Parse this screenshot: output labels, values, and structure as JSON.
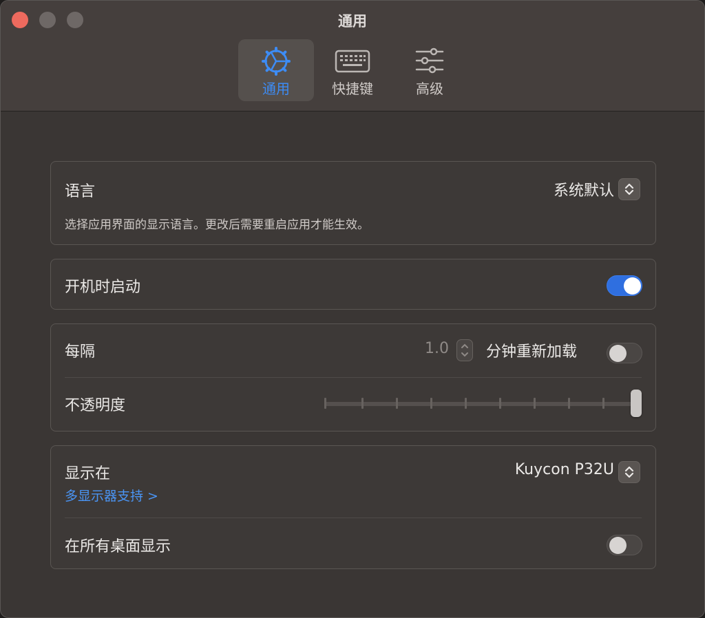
{
  "window": {
    "title": "通用"
  },
  "tabs": [
    {
      "label": "通用",
      "icon": "gear-icon",
      "active": true
    },
    {
      "label": "快捷键",
      "icon": "keyboard-icon",
      "active": false
    },
    {
      "label": "高级",
      "icon": "sliders-icon",
      "active": false
    }
  ],
  "language": {
    "label": "语言",
    "value": "系统默认",
    "description": "选择应用界面的显示语言。更改后需要重启应用才能生效。"
  },
  "startup": {
    "label": "开机时启动",
    "enabled": true
  },
  "reload": {
    "label": "每隔",
    "interval": "1.0",
    "suffix": "分钟重新加载",
    "enabled": false
  },
  "opacity": {
    "label": "不透明度",
    "value": 1.0
  },
  "display": {
    "label": "显示在",
    "value": "Kuycon P32U",
    "link": "多显示器支持 >",
    "all_desktops_label": "在所有桌面显示",
    "all_desktops_enabled": false
  },
  "colors": {
    "accent": "#3d8cf5",
    "toggle_on": "#2f6fe0",
    "close": "#ed6a5e"
  }
}
